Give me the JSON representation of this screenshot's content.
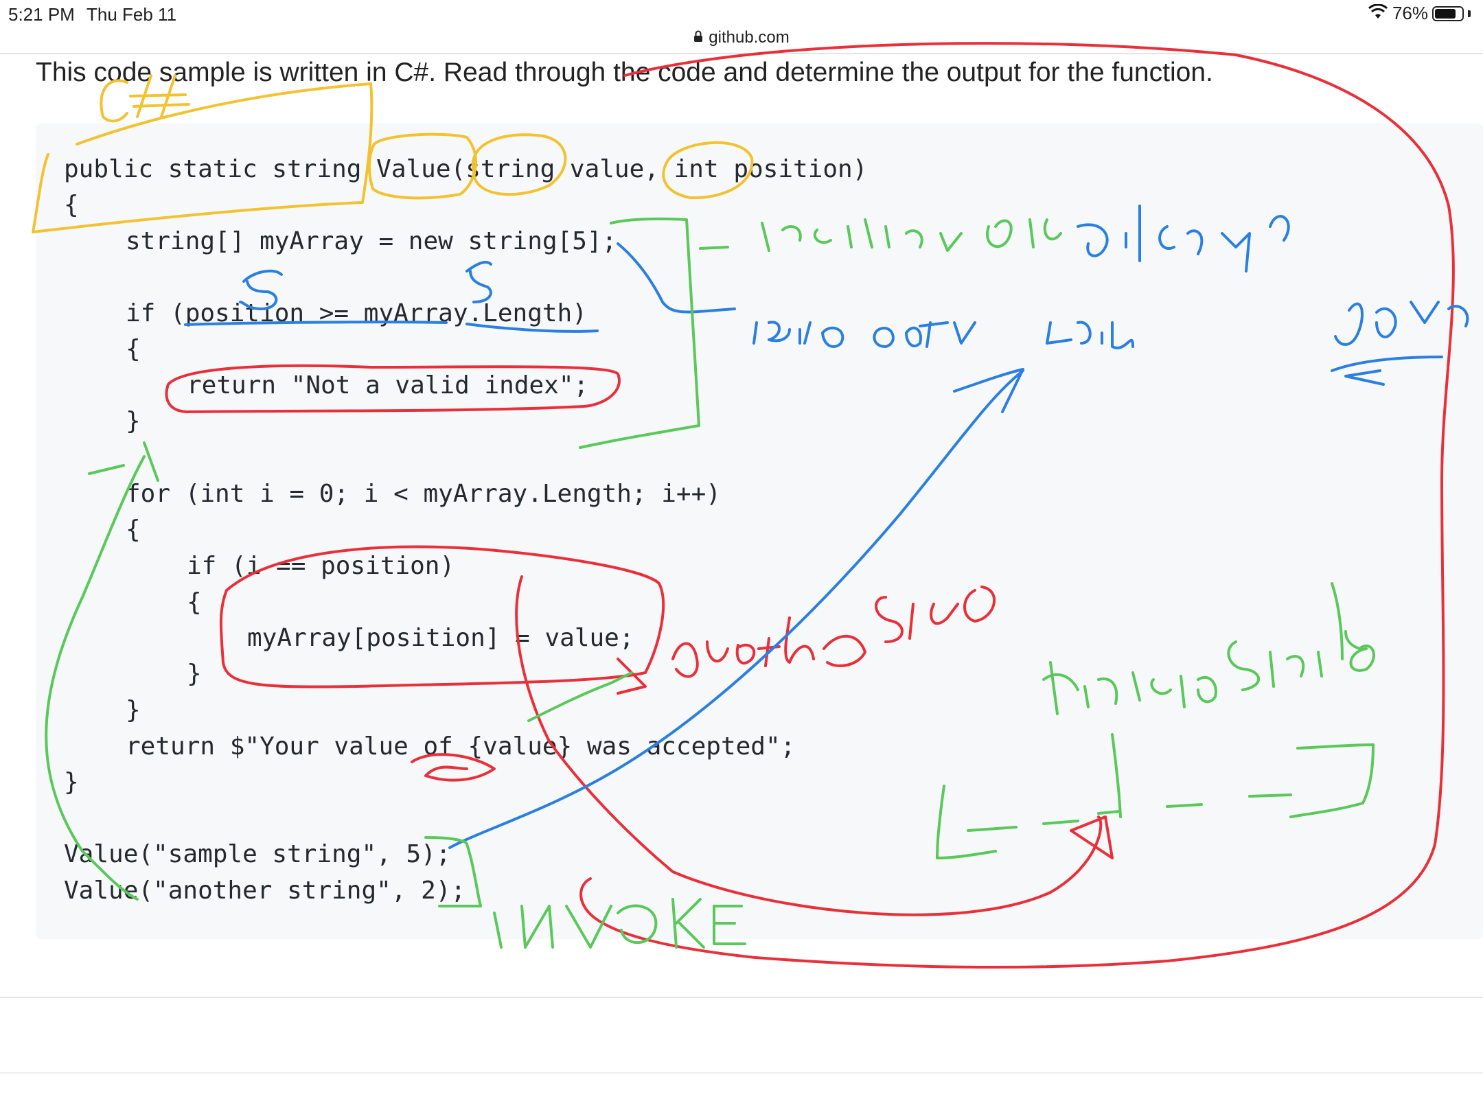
{
  "status_bar": {
    "time": "5:21 PM",
    "date": "Thu Feb 11",
    "battery": "76%",
    "battery_level": 0.76
  },
  "browser": {
    "url": "github.com"
  },
  "prompt_text": "This code sample is written in C#. Read through the code and determine the output for the function.",
  "code_lines": [
    "public static string Value(string value, int position)",
    "{",
    "string[] myArray = new string[5];",
    "if (position >= myArray.Length)",
    "{",
    "return \"Not a valid index\";",
    "}",
    "for (int i = 0; i < myArray.Length; i++)",
    "{",
    "if (i == position)",
    "{",
    "myArray[position] = value;",
    "}",
    "}",
    "return $\"Your value of {value} was accepted\";",
    "}",
    "Value(\"sample string\", 5);",
    "Value(\"another string\", 2);"
  ],
  "annotation_colors": {
    "yellow": "#f2c230",
    "red": "#e8303a",
    "blue": "#2b7fe0",
    "green": "#5ac85a"
  }
}
